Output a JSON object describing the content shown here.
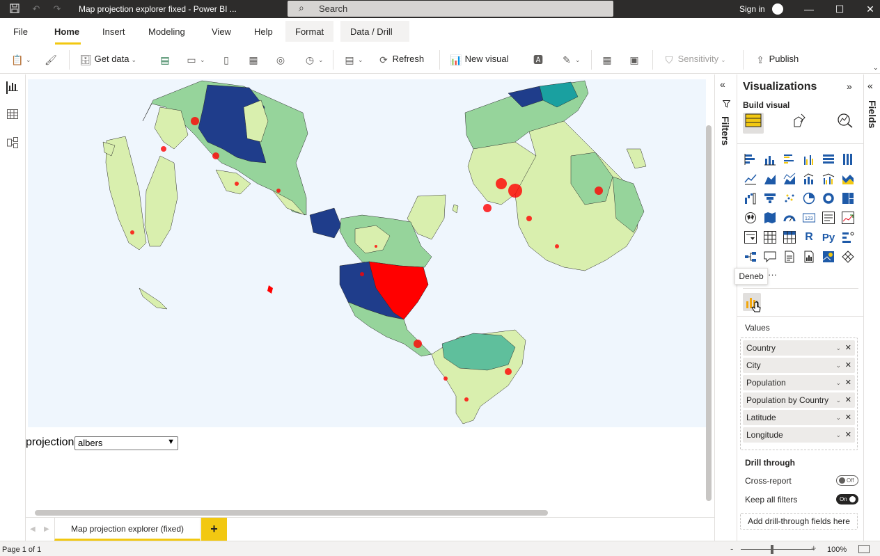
{
  "window": {
    "title": "Map projection explorer fixed - Power BI ...",
    "search_placeholder": "Search",
    "sign_in": "Sign in"
  },
  "menu": {
    "items": [
      "File",
      "Home",
      "Insert",
      "Modeling",
      "View",
      "Help"
    ],
    "active": "Home",
    "context_tabs": [
      "Format",
      "Data / Drill"
    ]
  },
  "ribbon": {
    "get_data": "Get data",
    "refresh": "Refresh",
    "new_visual": "New visual",
    "sensitivity": "Sensitivity",
    "publish": "Publish"
  },
  "report": {
    "projection_label": "projection",
    "projection_value": "albers",
    "page_tab": "Map projection explorer (fixed)",
    "add_page": "+"
  },
  "filters": {
    "label": "Filters"
  },
  "visualizations": {
    "title": "Visualizations",
    "build_visual": "Build visual",
    "tooltip": "Deneb",
    "more": "···",
    "values_label": "Values",
    "values": [
      "Country",
      "City",
      "Population",
      "Population by Country",
      "Latitude",
      "Longitude"
    ],
    "drill_through": "Drill through",
    "cross_report": "Cross-report",
    "cross_report_state": "Off",
    "keep_all_filters": "Keep all filters",
    "keep_all_filters_state": "On",
    "add_drill_through": "Add drill-through fields here"
  },
  "fields": {
    "label": "Fields"
  },
  "status": {
    "page": "Page 1 of 1",
    "zoom": "100%"
  },
  "colors": {
    "accent": "#f2c811",
    "land_light": "#d9efae",
    "land_medium": "#96d49b",
    "land_teal": "#5fbf9c",
    "land_dark": "#1f3d8b",
    "points": "#ff0000",
    "ocean": "#eff6fd"
  }
}
